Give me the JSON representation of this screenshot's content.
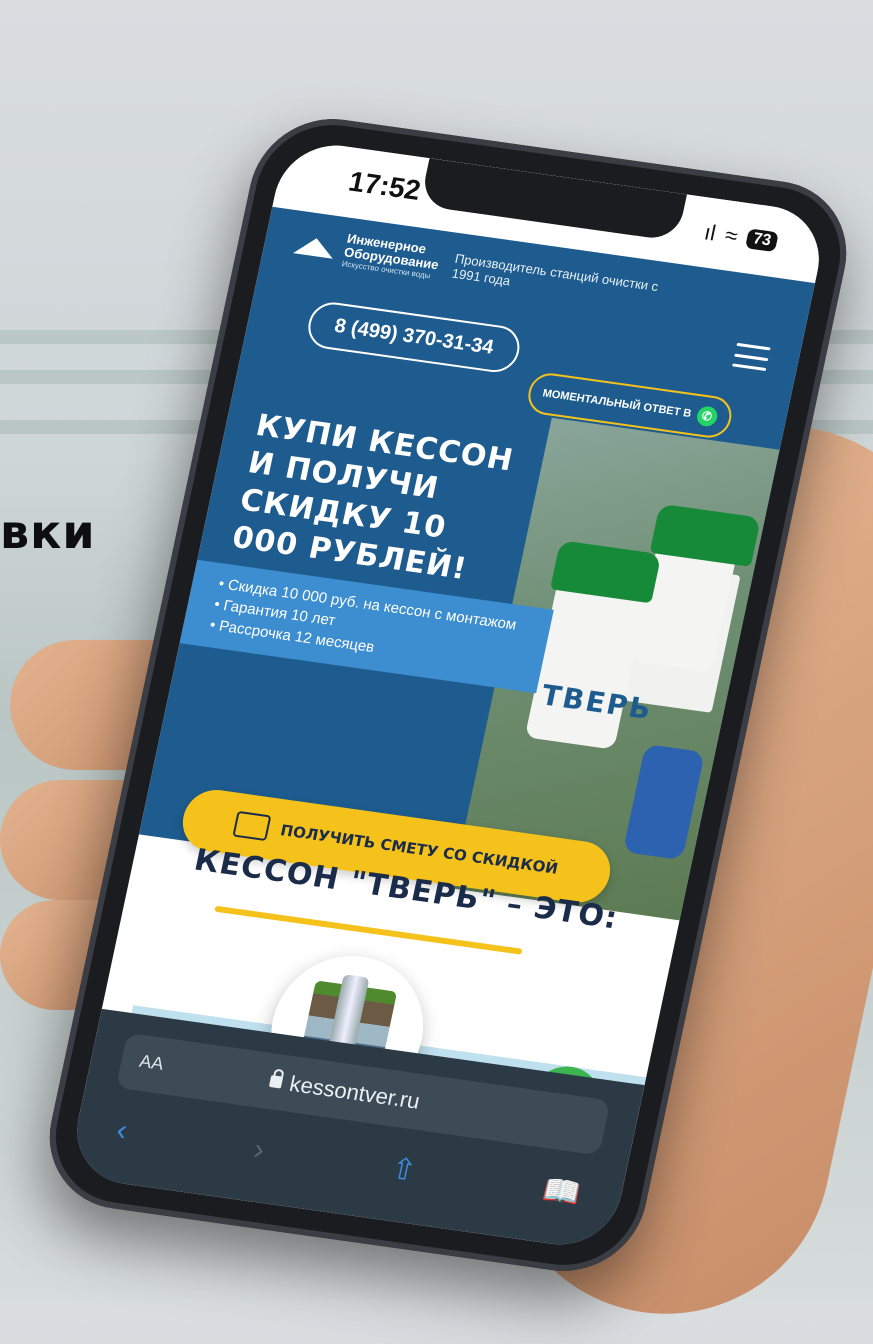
{
  "background": {
    "partial_word": "вки"
  },
  "status_bar": {
    "time": "17:52",
    "signal": "ıl",
    "wifi": "≈",
    "battery": "73"
  },
  "site": {
    "logo": {
      "name": "Инженерное Оборудование",
      "subtitle": "Искусство очистки воды"
    },
    "tagline": "Производитель станций очистки с 1991 года",
    "phone": "8 (499) 370-31-34",
    "whatsapp_button": "МОМЕНТАЛЬНЫЙ ОТВЕТ В",
    "headline": "КУПИ КЕССОН И ПОЛУЧИ СКИДКУ 10 000 РУБЛЕЙ!",
    "bullets": [
      "Скидка 10 000 руб. на кессон с монтажом",
      "Гарантия 10 лет",
      "Рассрочка 12 месяцев"
    ],
    "product_brand": "ТВЕРЬ",
    "cta_button": "ПОЛУЧИТЬ СМЕТУ СО СКИДКОЙ",
    "section_title": "КЕССОН \"ТВЕРЬ\" – ЭТО:"
  },
  "browser": {
    "aa_label": "AA",
    "url": "kessontver.ru",
    "back": "‹",
    "forward": "›",
    "share": "⇧",
    "bookmarks": "📖"
  },
  "colors": {
    "brand_blue": "#1e5c8f",
    "accent_yellow": "#f4c21b",
    "whatsapp_green": "#25d366",
    "call_green": "#3cb551"
  }
}
